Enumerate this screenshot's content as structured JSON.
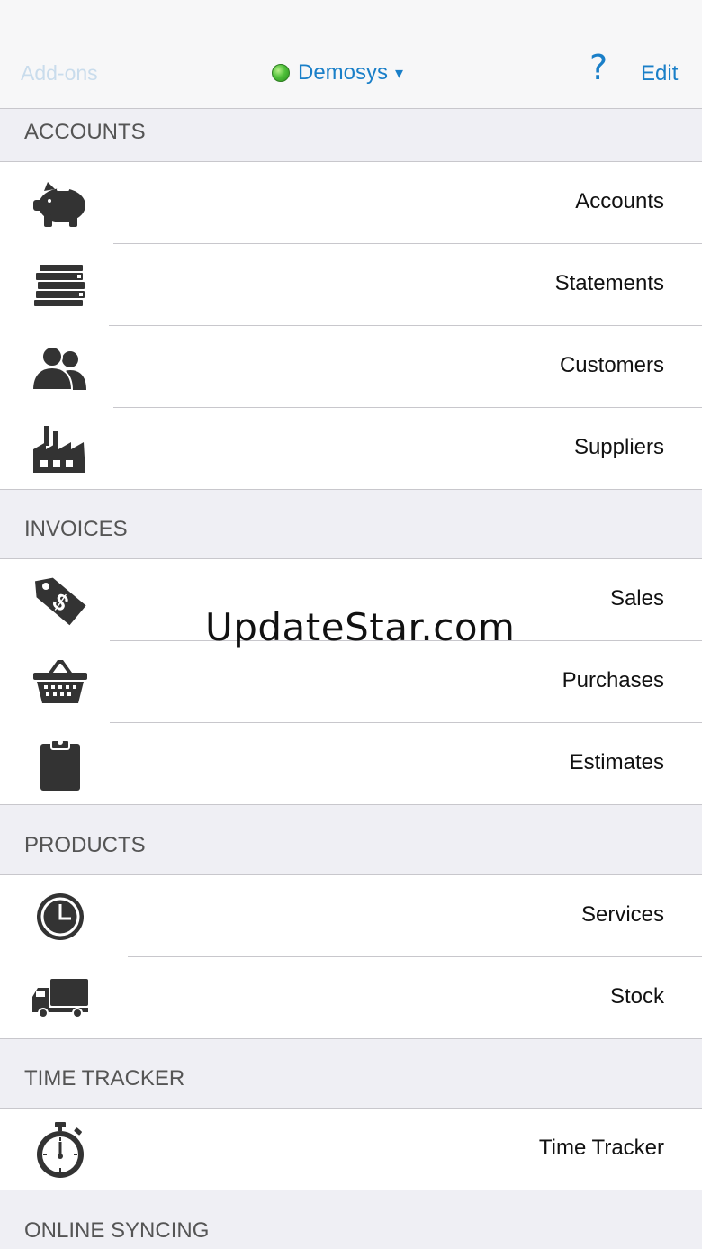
{
  "nav": {
    "left_label": "Add-ons",
    "company": "Demosys",
    "caret": "▾",
    "help": "?",
    "edit_label": "Edit"
  },
  "sections": {
    "accounts": {
      "header": "ACCOUNTS",
      "items": [
        {
          "label": "Accounts",
          "icon": "piggy-bank-icon"
        },
        {
          "label": "Statements",
          "icon": "stacked-books-icon"
        },
        {
          "label": "Customers",
          "icon": "people-icon"
        },
        {
          "label": "Suppliers",
          "icon": "factory-icon"
        }
      ]
    },
    "invoices": {
      "header": "INVOICES",
      "items": [
        {
          "label": "Sales",
          "icon": "price-tag-icon"
        },
        {
          "label": "Purchases",
          "icon": "basket-icon"
        },
        {
          "label": "Estimates",
          "icon": "clipboard-icon"
        }
      ]
    },
    "products": {
      "header": "PRODUCTS",
      "items": [
        {
          "label": "Services",
          "icon": "clock-icon"
        },
        {
          "label": "Stock",
          "icon": "truck-icon"
        }
      ]
    },
    "time_tracker": {
      "header": "TIME TRACKER",
      "items": [
        {
          "label": "Time Tracker",
          "icon": "stopwatch-icon"
        }
      ]
    },
    "online_syncing": {
      "header": "ONLINE SYNCING"
    }
  },
  "watermark": "UpdateStar.com",
  "colors": {
    "accent": "#1a7fc8",
    "disabled": "#c9dcec",
    "status_green": "#4fc03a",
    "icon": "#333333"
  }
}
